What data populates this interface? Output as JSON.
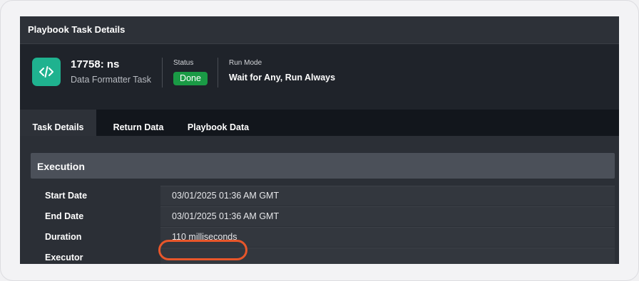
{
  "window": {
    "title": "Playbook Task Details"
  },
  "task": {
    "icon": "code-icon",
    "id": "17758: ns",
    "type": "Data Formatter Task",
    "status_label": "Status",
    "status": "Done",
    "run_mode_label": "Run Mode",
    "run_mode": "Wait for Any, Run Always"
  },
  "tabs": [
    {
      "label": "Task Details",
      "active": true
    },
    {
      "label": "Return Data",
      "active": false
    },
    {
      "label": "Playbook Data",
      "active": false
    }
  ],
  "section": {
    "title": "Execution"
  },
  "rows": [
    {
      "label": "Start Date",
      "value": "03/01/2025 01:36 AM GMT"
    },
    {
      "label": "End Date",
      "value": "03/01/2025 01:36 AM GMT"
    },
    {
      "label": "Duration",
      "value": "110 milliseconds"
    },
    {
      "label": "Executor",
      "value": ""
    }
  ],
  "colors": {
    "accent_icon": "#1fb28f",
    "status_done": "#1a9a45",
    "highlight": "#e8562a"
  }
}
